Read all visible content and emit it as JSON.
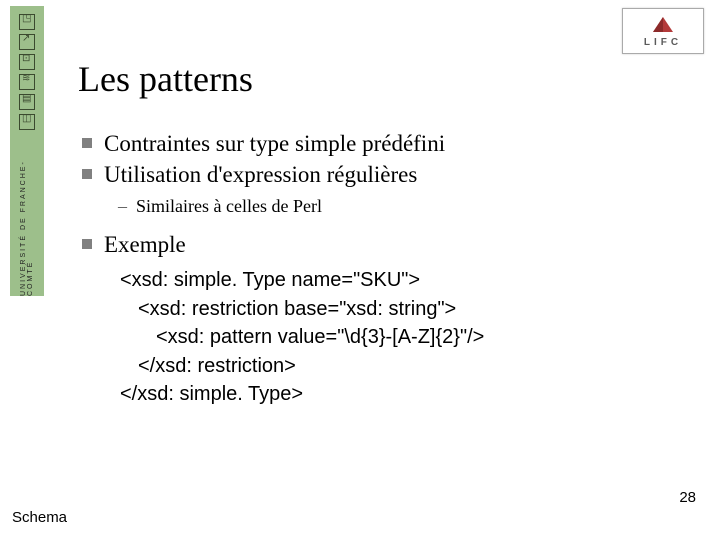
{
  "sidebar": {
    "vertical_text": "UNIVERSITÉ DE FRANCHE-COMTÉ"
  },
  "logo": {
    "text": "LIFC"
  },
  "title": "Les patterns",
  "bullets": {
    "b1": "Contraintes sur type simple prédéfini",
    "b2": "Utilisation d'expression régulières",
    "b2_sub1": "Similaires à celles de Perl",
    "b3": "Exemple"
  },
  "code": {
    "l1": "<xsd: simple. Type name=\"SKU\">",
    "l2": "<xsd: restriction base=\"xsd: string\">",
    "l3": "<xsd: pattern value=\"\\d{3}-[A-Z]{2}\"/>",
    "l4": "</xsd: restriction>",
    "l5": "</xsd: simple. Type>"
  },
  "page_number": "28",
  "footer": "Schema"
}
